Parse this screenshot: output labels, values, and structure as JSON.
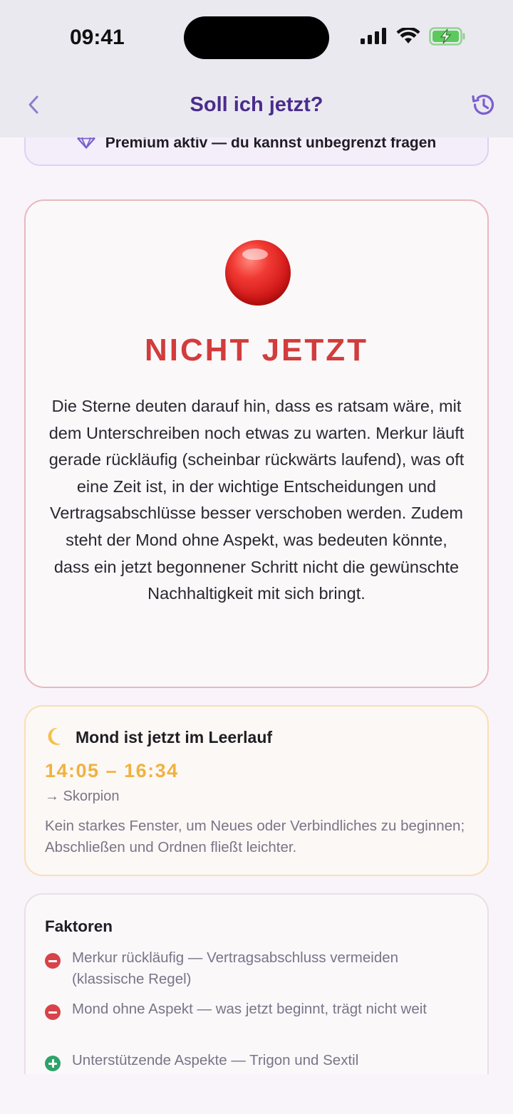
{
  "status_bar": {
    "time": "09:41",
    "icons": [
      "signal-icon",
      "wifi-icon",
      "battery-charging-icon"
    ],
    "battery_color": "#5cc95c"
  },
  "nav": {
    "title": "Soll ich jetzt?",
    "back_icon": "chevron-left-icon",
    "history_icon": "history-icon",
    "accent_color": "#7b5fd0"
  },
  "premium": {
    "icon": "diamond-icon",
    "text": "Premium aktiv — du kannst unbegrenzt fragen"
  },
  "verdict": {
    "indicator": "red-circle",
    "title": "NICHT JETZT",
    "title_color": "#d23c3c",
    "text": "Die Sterne deuten darauf hin, dass es ratsam wäre, mit dem Unterschreiben noch etwas zu warten. Merkur läuft gerade rückläufig (scheinbar rückwärts laufend), was oft eine Zeit ist, in der wichtige Entscheidungen und Vertragsabschlüsse besser verschoben werden. Zudem steht der Mond ohne Aspekt, was bedeuten könnte, dass ein jetzt begonnener Schritt nicht die gewünschte Nachhaltigkeit mit sich bringt."
  },
  "moon": {
    "icon": "crescent-moon-icon",
    "title": "Mond ist jetzt im Leerlauf",
    "time_range": "14:05 – 16:34",
    "time_color": "#f0b23e",
    "sign": "→ Skorpion",
    "description": "Kein starkes Fenster, um Neues oder Verbindliches zu beginnen; Abschließen und Ordnen fließt leichter."
  },
  "factors": {
    "title": "Faktoren",
    "items": [
      {
        "type": "negative",
        "icon": "minus-circle-icon",
        "text": "Merkur rückläufig — Vertragsabschluss vermeiden (klassische Regel)"
      },
      {
        "type": "negative",
        "icon": "minus-circle-icon",
        "text": "Mond ohne Aspekt — was jetzt beginnt, trägt nicht weit"
      },
      {
        "type": "positive",
        "icon": "plus-circle-icon",
        "text": "Unterstützende Aspekte — Trigon und Sextil"
      }
    ]
  }
}
